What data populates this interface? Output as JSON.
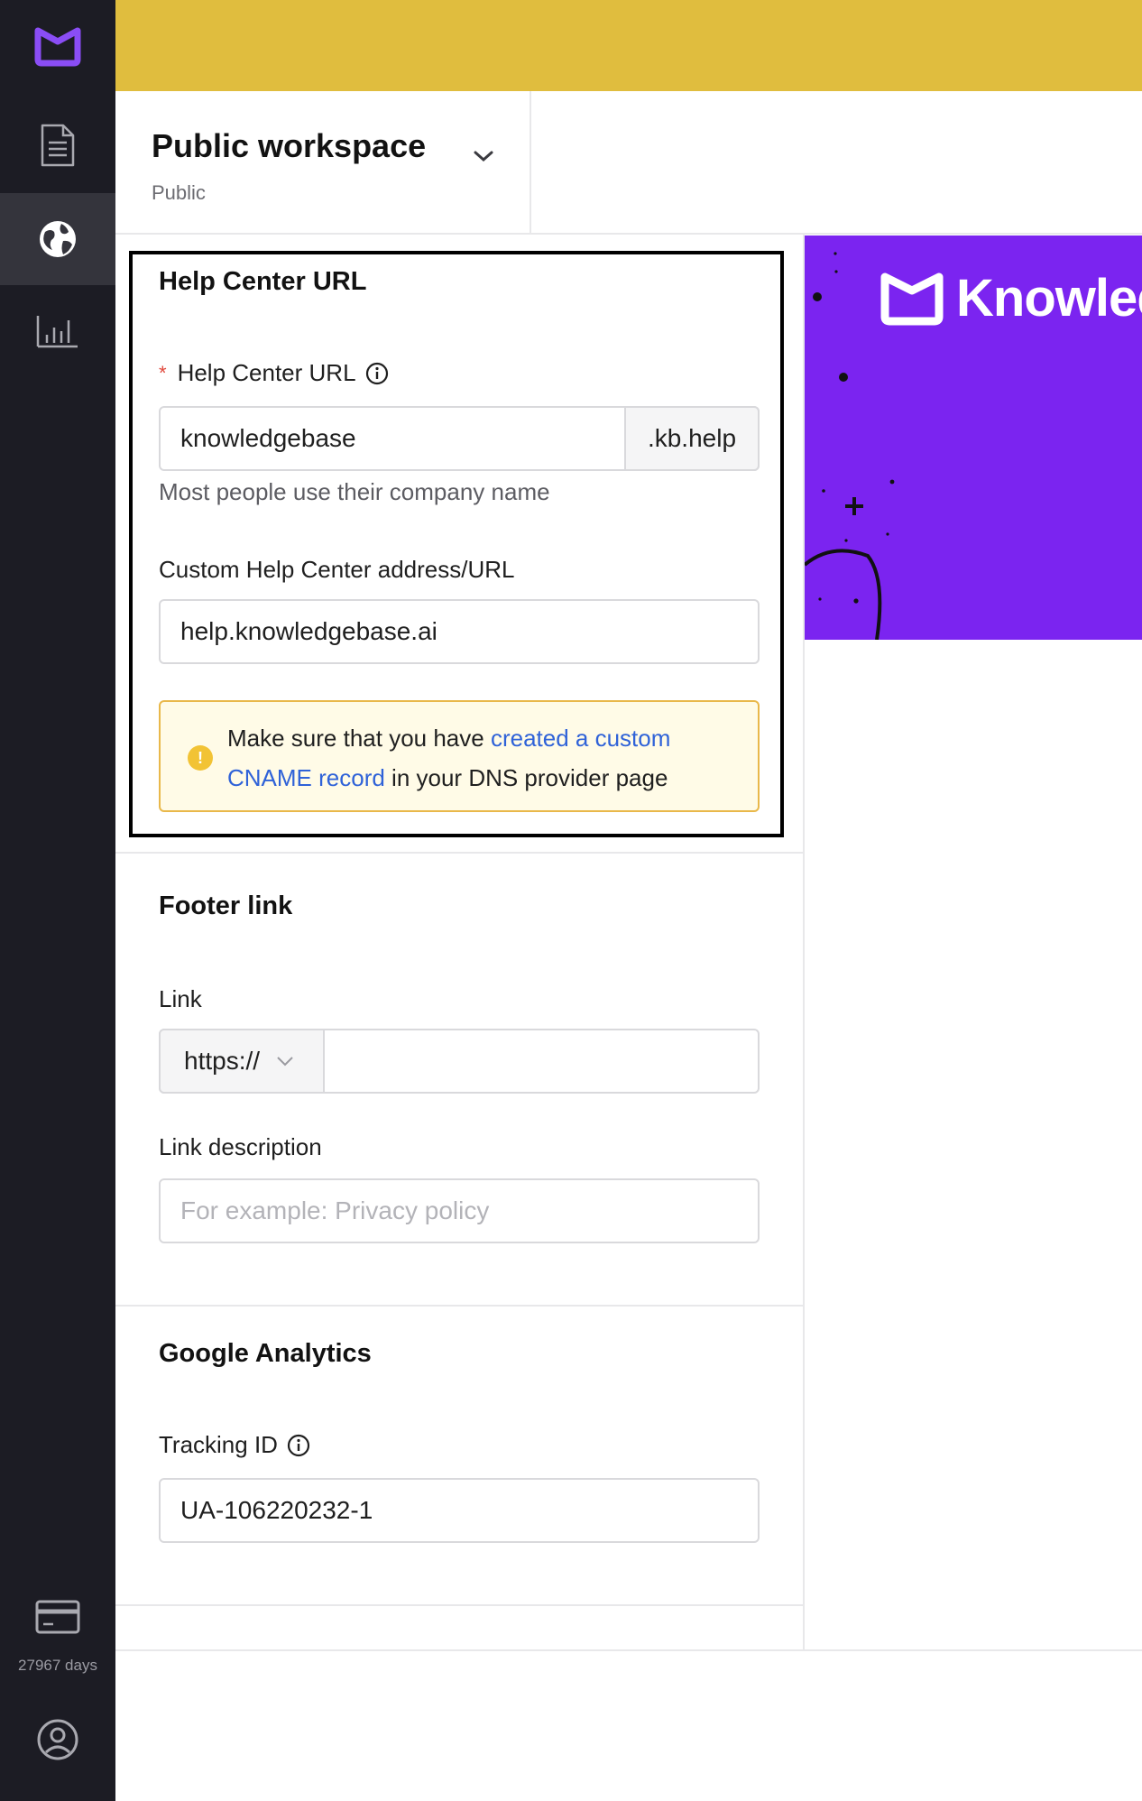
{
  "sidebar": {
    "subscription_days": "27967 days",
    "icons": [
      "logo-icon",
      "document-icon",
      "globe-icon",
      "analytics-icon",
      "billing-card-icon",
      "account-icon"
    ]
  },
  "workspace": {
    "title": "Public workspace",
    "subtitle": "Public"
  },
  "help_center_url": {
    "section_title": "Help Center URL",
    "field_label": "Help Center URL",
    "subdomain_value": "knowledgebase",
    "suffix": ".kb.help",
    "helper": "Most people use their company name",
    "custom_label": "Custom Help Center address/URL",
    "custom_value": "help.knowledgebase.ai",
    "alert": {
      "before": "Make sure that you have ",
      "link": "created a custom CNAME record",
      "after": " in your DNS provider page"
    }
  },
  "footer_link": {
    "section_title": "Footer link",
    "link_label": "Link",
    "protocol": "https://",
    "url_value": "",
    "description_label": "Link description",
    "description_placeholder": "For example: Privacy policy"
  },
  "google_analytics": {
    "section_title": "Google Analytics",
    "tracking_label": "Tracking ID",
    "tracking_value": "UA-106220232-1"
  },
  "preview": {
    "brand_text": "Knowledge"
  },
  "colors": {
    "sidebar_bg": "#1c1c24",
    "topbar": "#e0bd3e",
    "brand_purple": "#7b24f0",
    "link_blue": "#2f62d8",
    "alert_border": "#e9b84a"
  }
}
